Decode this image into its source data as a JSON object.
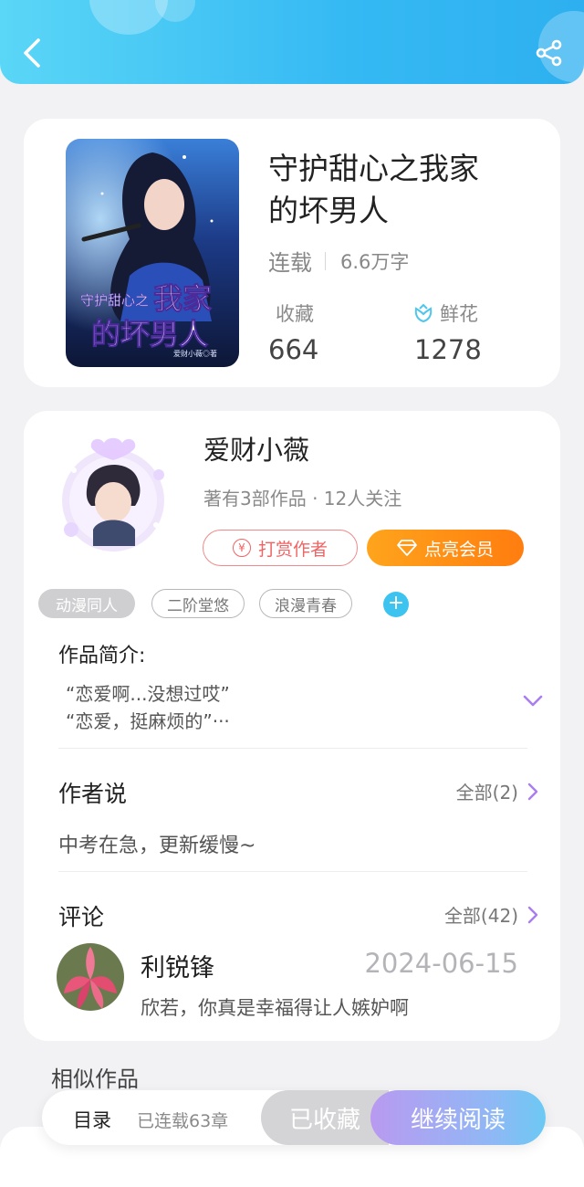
{
  "colors": {
    "header_start": "#5ad6f6",
    "header_end": "#2eb0f0",
    "accent_purple": "#a97ef0",
    "vip_orange": "#ff8a14",
    "reward_red": "#ef6464"
  },
  "header": {
    "back_icon": "chevron-left-icon",
    "share_icon": "share-icon"
  },
  "book": {
    "title_line1": "守护甜心之我家",
    "title_line2": "的坏男人",
    "status": "连载",
    "word_count": "6.6万字",
    "favorites_label": "收藏",
    "favorites_value": "664",
    "flowers_label": "鲜花",
    "flowers_value": "1278",
    "cover": {
      "title_small": "守护甜心之",
      "title_big_1": "我家",
      "title_big_2": "的坏男人",
      "author_small": "爱财小薇◎著"
    }
  },
  "author": {
    "name": "爱财小薇",
    "meta": "著有3部作品 · 12人关注",
    "reward_label": "打赏作者",
    "reward_icon_glyph": "¥",
    "vip_label": "点亮会员",
    "tags": [
      "动漫同人",
      "二阶堂悠",
      "浪漫青春"
    ],
    "add_tag": "+"
  },
  "intro": {
    "title": "作品简介:",
    "line1": "“恋爱啊...没想过哎”",
    "line2": "“恋爱，挺麻烦的”···"
  },
  "author_says": {
    "title": "作者说",
    "all_label": "全部(2)",
    "text": "中考在急，更新缓慢~"
  },
  "comments": {
    "title": "评论",
    "all_label": "全部(42)",
    "items": [
      {
        "name": "利锐锋",
        "date": "2024-06-15",
        "text": "欣若，你真是幸福得让人嫉妒啊"
      }
    ]
  },
  "similar": {
    "title": "相似作品"
  },
  "bottom_bar": {
    "toc_label": "目录",
    "toc_count": "已连载63章",
    "collected_label": "已收藏",
    "read_label": "继续阅读"
  }
}
